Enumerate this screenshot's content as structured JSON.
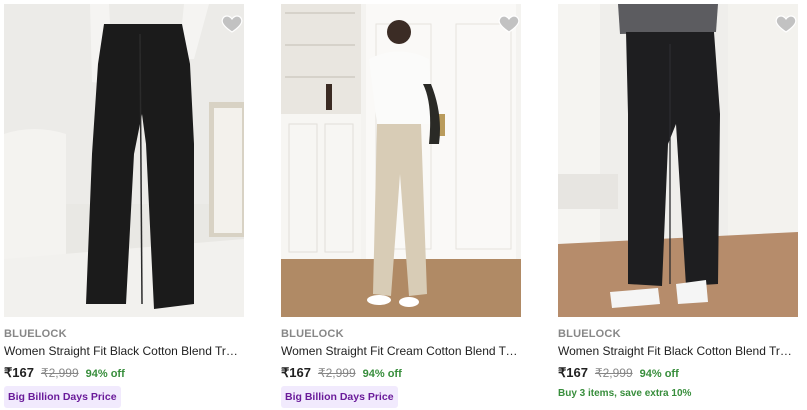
{
  "products": [
    {
      "brand": "BLUELOCK",
      "title": "Women Straight Fit Black Cotton Blend Trousers",
      "price": "₹167",
      "mrp": "₹2,999",
      "discount": "94% off",
      "badge": "Big Billion Days Price",
      "offer": "",
      "colors": {
        "pants": "#1b1b1b",
        "background": "#e9e8e4",
        "floor": "#f0efec"
      }
    },
    {
      "brand": "BLUELOCK",
      "title": "Women Straight Fit Cream Cotton Blend Trousers",
      "price": "₹167",
      "mrp": "₹2,999",
      "discount": "94% off",
      "badge": "Big Billion Days Price",
      "offer": "",
      "colors": {
        "pants": "#d8ccb6",
        "background": "#f4f3f0",
        "floor": "#b08a65"
      }
    },
    {
      "brand": "BLUELOCK",
      "title": "Women Straight Fit Black Cotton Blend Trousers",
      "price": "₹167",
      "mrp": "₹2,999",
      "discount": "94% off",
      "badge": "",
      "offer": "Buy 3 items, save extra 10%",
      "colors": {
        "pants": "#1e1e20",
        "background": "#efeeeb",
        "floor": "#b68c6b"
      }
    }
  ],
  "icons": {
    "wishlist": "heart-icon"
  },
  "theme": {
    "brand_gray": "#878787",
    "discount_green": "#388e3c",
    "badge_bg": "#f1eafd",
    "badge_text": "#6a1b9a"
  }
}
